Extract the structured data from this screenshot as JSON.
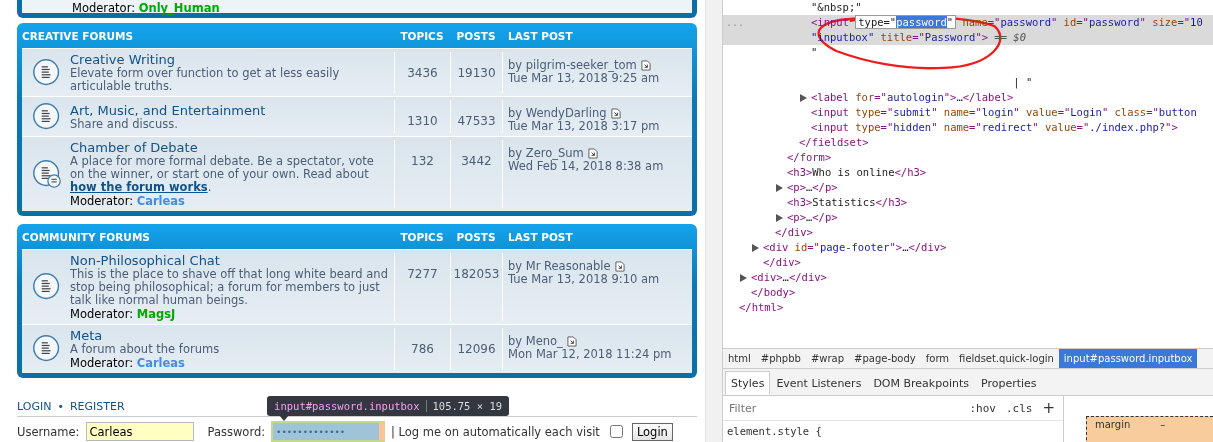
{
  "previous_panel": {
    "moderator": {
      "label": "Moderator:",
      "name": "Only_Human",
      "color": "#00aa00"
    }
  },
  "sections": [
    {
      "title": "CREATIVE FORUMS",
      "columns": [
        "TOPICS",
        "POSTS",
        "LAST POST"
      ],
      "forums": [
        {
          "kind": "forum",
          "title": "Creative Writing",
          "description": "Elevate form over function to get at less easily articulable truths.",
          "topics": "3436",
          "posts": "19130",
          "last_author": "by pilgrim-seeker_tom",
          "last_date": "Tue Mar 13, 2018 9:25 am"
        },
        {
          "kind": "forum",
          "title": "Art, Music, and Entertainment",
          "description": "Share and discuss.",
          "topics": "1310",
          "posts": "47533",
          "last_author": "by WendyDarling",
          "last_date": "Tue Mar 13, 2018 3:17 pm"
        },
        {
          "kind": "subforum",
          "title": "Chamber of Debate",
          "description": "A place for more formal debate. Be a spectator, vote on the winner, or start one of your own. Read about ",
          "link": "how the forum works",
          "description_end": ".",
          "moderator": {
            "label": "Moderator:",
            "name": "Carleas",
            "color": "#3f8ee6"
          },
          "topics": "132",
          "posts": "3442",
          "last_author": "by Zero_Sum",
          "last_date": "Wed Feb 14, 2018 8:38 am"
        }
      ]
    },
    {
      "title": "COMMUNITY FORUMS",
      "columns": [
        "TOPICS",
        "POSTS",
        "LAST POST"
      ],
      "forums": [
        {
          "kind": "forum",
          "title": "Non-Philosophical Chat",
          "description": "This is the place to shave off that long white beard and stop being philosophical; a forum for members to just talk like normal human beings.",
          "moderator": {
            "label": "Moderator:",
            "name": "MagsJ",
            "color": "#00aa00"
          },
          "topics": "7277",
          "posts": "182053",
          "last_author": "by Mr Reasonable",
          "last_date": "Tue Mar 13, 2018 9:10 am"
        },
        {
          "kind": "forum",
          "title": "Meta",
          "description": "A forum about the forums",
          "moderator": {
            "label": "Moderator:",
            "name": "Carleas",
            "color": "#3f8ee6"
          },
          "topics": "786",
          "posts": "12096",
          "last_author": "by Meno_",
          "last_date": "Mon Mar 12, 2018 11:24 pm"
        }
      ]
    }
  ],
  "login": {
    "links": [
      "LOGIN",
      "REGISTER"
    ],
    "separator": "•",
    "username_label": "Username:",
    "username": "Carleas",
    "password_label": "Password:",
    "password": "•••••••••••••",
    "password_inspected": true,
    "remember_label": "| Log me on automatically each visit",
    "remember_checked": false,
    "button": "Login",
    "tooltip": {
      "selector": "input#password.inputbox",
      "size": "105.75 × 19"
    }
  },
  "devtools": {
    "marker": "...",
    "tree": [
      {
        "children": [
          {
            "children": [
              {
                "children": [
                  {
                    "children": [
                      {
                        "children": [
                          {
                            "children": [
                              {
                                "arrow": false,
                                "selected": false,
                                "lines": [
                                  [
                                    {
                                      "kind": "text",
                                      "text": "\"&nbsp;\""
                                    }
                                  ]
                                ]
                              },
                              {
                                "arrow": false,
                                "selected": true,
                                "lines": [
                                  [
                                    {
                                      "kind": "tag",
                                      "text": "<input "
                                    },
                                    {
                                      "kind": "edit-start",
                                      "text": "type=\""
                                    },
                                    {
                                      "kind": "edit-selection",
                                      "text": "password"
                                    },
                                    {
                                      "kind": "edit-end",
                                      "text": "\""
                                    },
                                    {
                                      "kind": "attr",
                                      "text": " name"
                                    },
                                    {
                                      "kind": "tag",
                                      "text": "=\""
                                    },
                                    {
                                      "kind": "value",
                                      "text": "password"
                                    },
                                    {
                                      "kind": "tag",
                                      "text": "\""
                                    },
                                    {
                                      "kind": "attr",
                                      "text": " id"
                                    },
                                    {
                                      "kind": "tag",
                                      "text": "=\""
                                    },
                                    {
                                      "kind": "value",
                                      "text": "password"
                                    },
                                    {
                                      "kind": "tag",
                                      "text": "\""
                                    },
                                    {
                                      "kind": "attr",
                                      "text": " size"
                                    },
                                    {
                                      "kind": "tag",
                                      "text": "=\""
                                    },
                                    {
                                      "kind": "value",
                                      "text": "10"
                                    }
                                  ],
                                  [
                                    {
                                      "kind": "value",
                                      "text": "\"inputbox\""
                                    },
                                    {
                                      "kind": "attr",
                                      "text": " title"
                                    },
                                    {
                                      "kind": "tag",
                                      "text": "=\""
                                    },
                                    {
                                      "kind": "value",
                                      "text": "Password"
                                    },
                                    {
                                      "kind": "tag",
                                      "text": "\">"
                                    },
                                    {
                                      "kind": "comment",
                                      "text": " == $0"
                                    }
                                  ]
                                ]
                              },
                              {
                                "arrow": false,
                                "selected": false,
                                "lines": [
                                  [
                                    {
                                      "kind": "text",
                                      "text": "\"\n\n                                | \""
                                    }
                                  ]
                                ]
                              },
                              {
                                "arrow": true,
                                "selected": false,
                                "lines": [
                                  [
                                    {
                                      "kind": "tag",
                                      "text": "<label "
                                    },
                                    {
                                      "kind": "attr",
                                      "text": "for"
                                    },
                                    {
                                      "kind": "tag",
                                      "text": "=\""
                                    },
                                    {
                                      "kind": "value",
                                      "text": "autologin"
                                    },
                                    {
                                      "kind": "tag",
                                      "text": "\">"
                                    },
                                    {
                                      "kind": "text",
                                      "text": "…"
                                    },
                                    {
                                      "kind": "tag",
                                      "text": "</label>"
                                    }
                                  ]
                                ]
                              },
                              {
                                "arrow": false,
                                "selected": false,
                                "lines": [
                                  [
                                    {
                                      "kind": "tag",
                                      "text": "<input "
                                    },
                                    {
                                      "kind": "attr",
                                      "text": "type"
                                    },
                                    {
                                      "kind": "tag",
                                      "text": "=\""
                                    },
                                    {
                                      "kind": "value",
                                      "text": "submit"
                                    },
                                    {
                                      "kind": "tag",
                                      "text": "\""
                                    },
                                    {
                                      "kind": "attr",
                                      "text": " name"
                                    },
                                    {
                                      "kind": "tag",
                                      "text": "=\""
                                    },
                                    {
                                      "kind": "value",
                                      "text": "login"
                                    },
                                    {
                                      "kind": "tag",
                                      "text": "\""
                                    },
                                    {
                                      "kind": "attr",
                                      "text": " value"
                                    },
                                    {
                                      "kind": "tag",
                                      "text": "=\""
                                    },
                                    {
                                      "kind": "value",
                                      "text": "Login"
                                    },
                                    {
                                      "kind": "tag",
                                      "text": "\""
                                    },
                                    {
                                      "kind": "attr",
                                      "text": " class"
                                    },
                                    {
                                      "kind": "tag",
                                      "text": "=\""
                                    },
                                    {
                                      "kind": "value",
                                      "text": "button"
                                    }
                                  ]
                                ]
                              },
                              {
                                "arrow": false,
                                "selected": false,
                                "lines": [
                                  [
                                    {
                                      "kind": "tag",
                                      "text": "<input "
                                    },
                                    {
                                      "kind": "attr",
                                      "text": "type"
                                    },
                                    {
                                      "kind": "tag",
                                      "text": "=\""
                                    },
                                    {
                                      "kind": "value",
                                      "text": "hidden"
                                    },
                                    {
                                      "kind": "tag",
                                      "text": "\""
                                    },
                                    {
                                      "kind": "attr",
                                      "text": " name"
                                    },
                                    {
                                      "kind": "tag",
                                      "text": "=\""
                                    },
                                    {
                                      "kind": "value",
                                      "text": "redirect"
                                    },
                                    {
                                      "kind": "tag",
                                      "text": "\""
                                    },
                                    {
                                      "kind": "attr",
                                      "text": " value"
                                    },
                                    {
                                      "kind": "tag",
                                      "text": "=\""
                                    },
                                    {
                                      "kind": "value",
                                      "text": "./index.php?"
                                    },
                                    {
                                      "kind": "tag",
                                      "text": "\">"
                                    }
                                  ]
                                ]
                              }
                            ]
                          },
                          {
                            "arrow": false,
                            "selected": false,
                            "lines": [
                              [
                                {
                                  "kind": "tag",
                                  "text": "</fieldset>"
                                }
                              ]
                            ]
                          }
                        ]
                      },
                      {
                        "arrow": false,
                        "selected": false,
                        "lines": [
                          [
                            {
                              "kind": "tag",
                              "text": "</form>"
                            }
                          ]
                        ]
                      },
                      {
                        "arrow": false,
                        "selected": false,
                        "lines": [
                          [
                            {
                              "kind": "tag",
                              "text": "<h3>"
                            },
                            {
                              "kind": "text",
                              "text": "Who is online"
                            },
                            {
                              "kind": "tag",
                              "text": "</h3>"
                            }
                          ]
                        ]
                      },
                      {
                        "arrow": true,
                        "selected": false,
                        "lines": [
                          [
                            {
                              "kind": "tag",
                              "text": "<p>"
                            },
                            {
                              "kind": "text",
                              "text": "…"
                            },
                            {
                              "kind": "tag",
                              "text": "</p>"
                            }
                          ]
                        ]
                      },
                      {
                        "arrow": false,
                        "selected": false,
                        "lines": [
                          [
                            {
                              "kind": "tag",
                              "text": "<h3>"
                            },
                            {
                              "kind": "text",
                              "text": "Statistics"
                            },
                            {
                              "kind": "tag",
                              "text": "</h3>"
                            }
                          ]
                        ]
                      },
                      {
                        "arrow": true,
                        "selected": false,
                        "lines": [
                          [
                            {
                              "kind": "tag",
                              "text": "<p>"
                            },
                            {
                              "kind": "text",
                              "text": "…"
                            },
                            {
                              "kind": "tag",
                              "text": "</p>"
                            }
                          ]
                        ]
                      }
                    ]
                  },
                  {
                    "arrow": false,
                    "selected": false,
                    "lines": [
                      [
                        {
                          "kind": "tag",
                          "text": "</div>"
                        }
                      ]
                    ]
                  }
                ]
              },
              {
                "arrow": true,
                "selected": false,
                "lines": [
                  [
                    {
                      "kind": "tag",
                      "text": "<div "
                    },
                    {
                      "kind": "attr",
                      "text": "id"
                    },
                    {
                      "kind": "tag",
                      "text": "=\""
                    },
                    {
                      "kind": "value",
                      "text": "page-footer"
                    },
                    {
                      "kind": "tag",
                      "text": "\">"
                    },
                    {
                      "kind": "text",
                      "text": "…"
                    },
                    {
                      "kind": "tag",
                      "text": "</div>"
                    }
                  ]
                ]
              },
              {
                "arrow": false,
                "selected": false,
                "lines": [
                  [
                    {
                      "kind": "tag",
                      "text": "</div>"
                    }
                  ]
                ]
              }
            ]
          },
          {
            "arrow": true,
            "selected": false,
            "lines": [
              [
                {
                  "kind": "tag",
                  "text": "<div>"
                },
                {
                  "kind": "text",
                  "text": "…"
                },
                {
                  "kind": "tag",
                  "text": "</div>"
                }
              ]
            ]
          },
          {
            "arrow": false,
            "selected": false,
            "lines": [
              [
                {
                  "kind": "tag",
                  "text": "</body>"
                }
              ]
            ]
          }
        ]
      },
      {
        "arrow": false,
        "selected": false,
        "lines": [
          [
            {
              "kind": "tag",
              "text": "</html>"
            }
          ]
        ]
      }
    ],
    "breadcrumbs": [
      {
        "label": "html",
        "selected": false
      },
      {
        "label": "#phpbb",
        "selected": false
      },
      {
        "label": "#wrap",
        "selected": false
      },
      {
        "label": "#page-body",
        "selected": false
      },
      {
        "label": "form",
        "selected": false
      },
      {
        "label": "fieldset.quick-login",
        "selected": false
      },
      {
        "label": "input#password.inputbox",
        "selected": true
      }
    ],
    "tabs": [
      {
        "label": "Styles",
        "selected": true
      },
      {
        "label": "Event Listeners",
        "selected": false
      },
      {
        "label": "DOM Breakpoints",
        "selected": false
      },
      {
        "label": "Properties",
        "selected": false
      }
    ],
    "filter_placeholder": "Filter",
    "hov": ":hov",
    "cls": ".cls",
    "add": "+",
    "element_style": "element.style {",
    "box_model": {
      "label": "margin",
      "value": "–"
    }
  }
}
